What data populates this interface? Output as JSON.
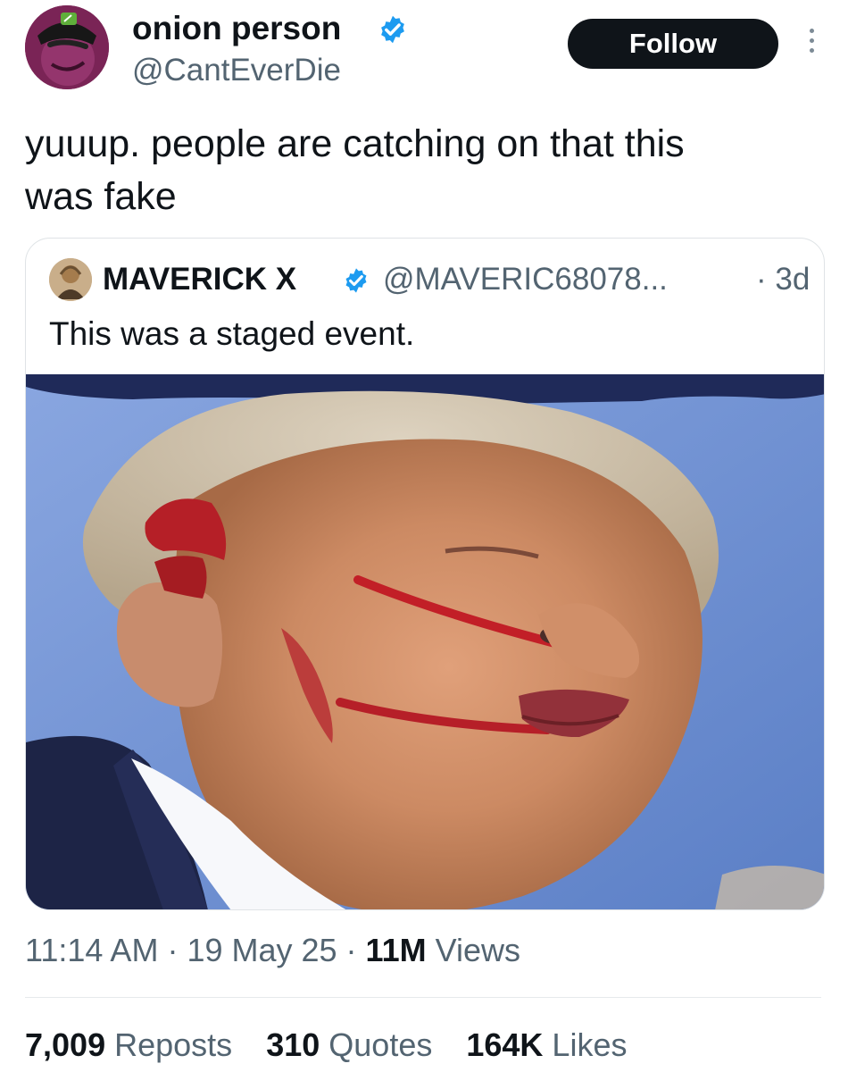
{
  "post": {
    "author": {
      "display_name": "onion person",
      "handle": "@CantEverDie",
      "verified": true,
      "verified_icon": "verified-badge-icon"
    },
    "follow_label": "Follow",
    "more_icon": "more-options-icon",
    "text": "yuuup.  people are catching on that this\nwas fake",
    "quoted_tweet": {
      "display_name": "MAVERICK X",
      "handle": "@MAVERIC68078...",
      "time": "· 3d",
      "text": "This was a staged event.",
      "verified": true,
      "verified_icon": "verified-badge-icon"
    },
    "meta": {
      "time": "11:14 AM",
      "separator_1": " · ",
      "date": "19 May 25",
      "separator_2": " · ",
      "views_count": "11M",
      "views_label": " Views"
    },
    "stats": {
      "reposts_count": "7,009",
      "reposts_label": " Reposts",
      "quotes_count": "310",
      "quotes_label": " Quotes",
      "likes_count": "164K",
      "likes_label": " Likes"
    }
  },
  "colors": {
    "text_primary": "#0f1419",
    "text_secondary": "#536471",
    "verified_blue": "#1d9bf0",
    "follow_button_bg": "#0f1419",
    "follow_button_text": "#ffffff",
    "photo_sky": "#6f8fd1",
    "card_border": "#dfe3e6"
  }
}
